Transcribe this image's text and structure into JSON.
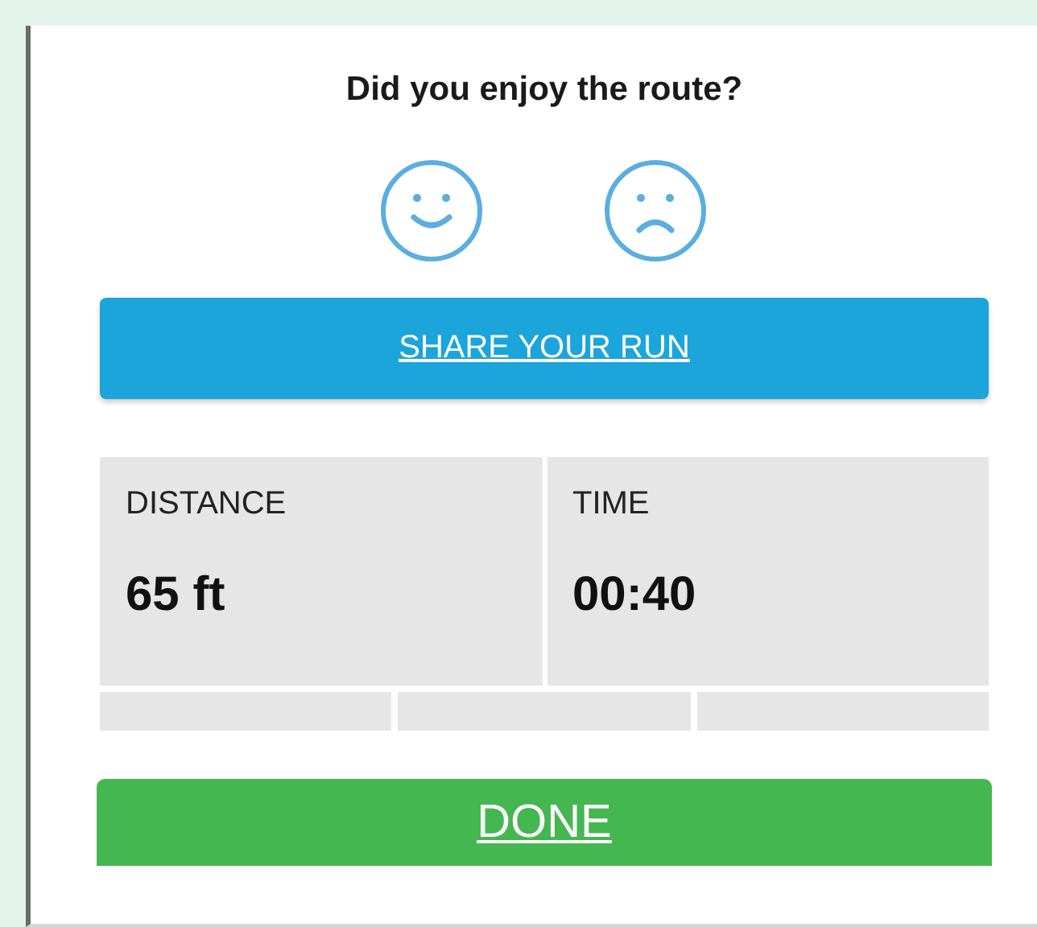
{
  "question": "Did you enjoy the route?",
  "ratings": [
    {
      "kind": "happy"
    },
    {
      "kind": "sad"
    }
  ],
  "share_button": "SHARE YOUR RUN",
  "stats_row_1": [
    {
      "label": "DISTANCE",
      "value": "65 ft"
    },
    {
      "label": "TIME",
      "value": "00:40"
    }
  ],
  "done_button": "DONE"
}
